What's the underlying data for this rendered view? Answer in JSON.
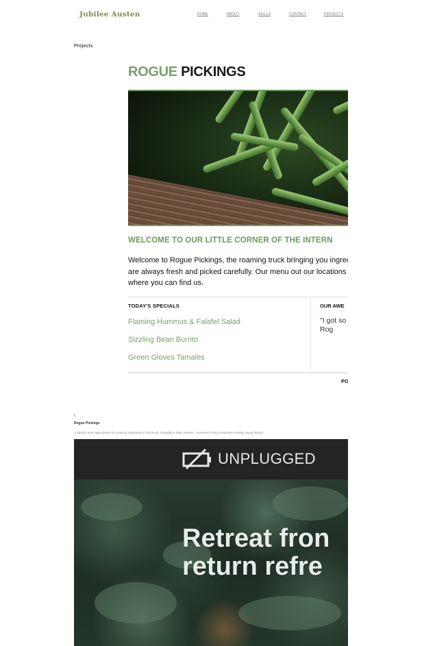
{
  "header": {
    "brand": "Jubilee Austen",
    "nav": [
      "HOME",
      "ABOUT",
      "SKILLS",
      "CONTACT",
      "PROJECTS"
    ]
  },
  "section_label": "Projects",
  "project1": {
    "title_green": "ROGUE",
    "title_dark": "PICKINGS",
    "welcome": "WELCOME TO OUR LITTLE CORNER OF THE INTERN",
    "intro": "Welcome to Rogue Pickings, the roaming truck bringing you ingredients are always fresh and picked carefully. Our menu out our locations to see where you can find us.",
    "specials_heading": "TODAY'S SPECIALS",
    "specials": [
      "Flaming Hummus & Falafel Salad",
      "Sizzling Bean Burrito",
      "Green Gloves Tamales"
    ],
    "reviews_heading": "OUR AWE",
    "review": "\"I got so falafel sa inhale n was sup you Rog",
    "review_cut": "PO"
  },
  "caption": {
    "mark": "L",
    "name": "Rogue Pickings",
    "description": "A simple home page perfect for a pop-up restaurant or food truck. Originally a static website, I converted it into a responsive design using Flexbox."
  },
  "project2": {
    "logo_text": "UNPLUGGED",
    "hero_line1": "Retreat fron",
    "hero_line2": "return refre"
  }
}
